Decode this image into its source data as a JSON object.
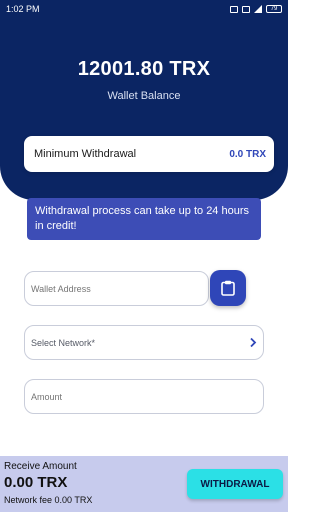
{
  "status": {
    "time": "1:02 PM",
    "battery": "79"
  },
  "balance": {
    "amount": "12001.80 TRX",
    "label": "Wallet Balance"
  },
  "minimum": {
    "label": "Minimum Withdrawal",
    "value": "0.0 TRX"
  },
  "info": {
    "message": "Withdrawal process can take up to 24 hours in credit!"
  },
  "form": {
    "wallet_placeholder": "Wallet Address",
    "network_placeholder": "Select Network*",
    "amount_placeholder": "Amount"
  },
  "footer": {
    "receive_label": "Receive Amount",
    "receive_value": "0.00 TRX",
    "fee": "Network fee 0.00 TRX",
    "button_label": "WITHDRAWAL"
  },
  "colors": {
    "header": "#0b2563",
    "accent": "#2f46b8",
    "button": "#2be0e6",
    "footer": "#c7cbed"
  },
  "icons": [
    "clipboard-icon",
    "chevron-right-icon",
    "signal-icon",
    "battery-icon"
  ]
}
